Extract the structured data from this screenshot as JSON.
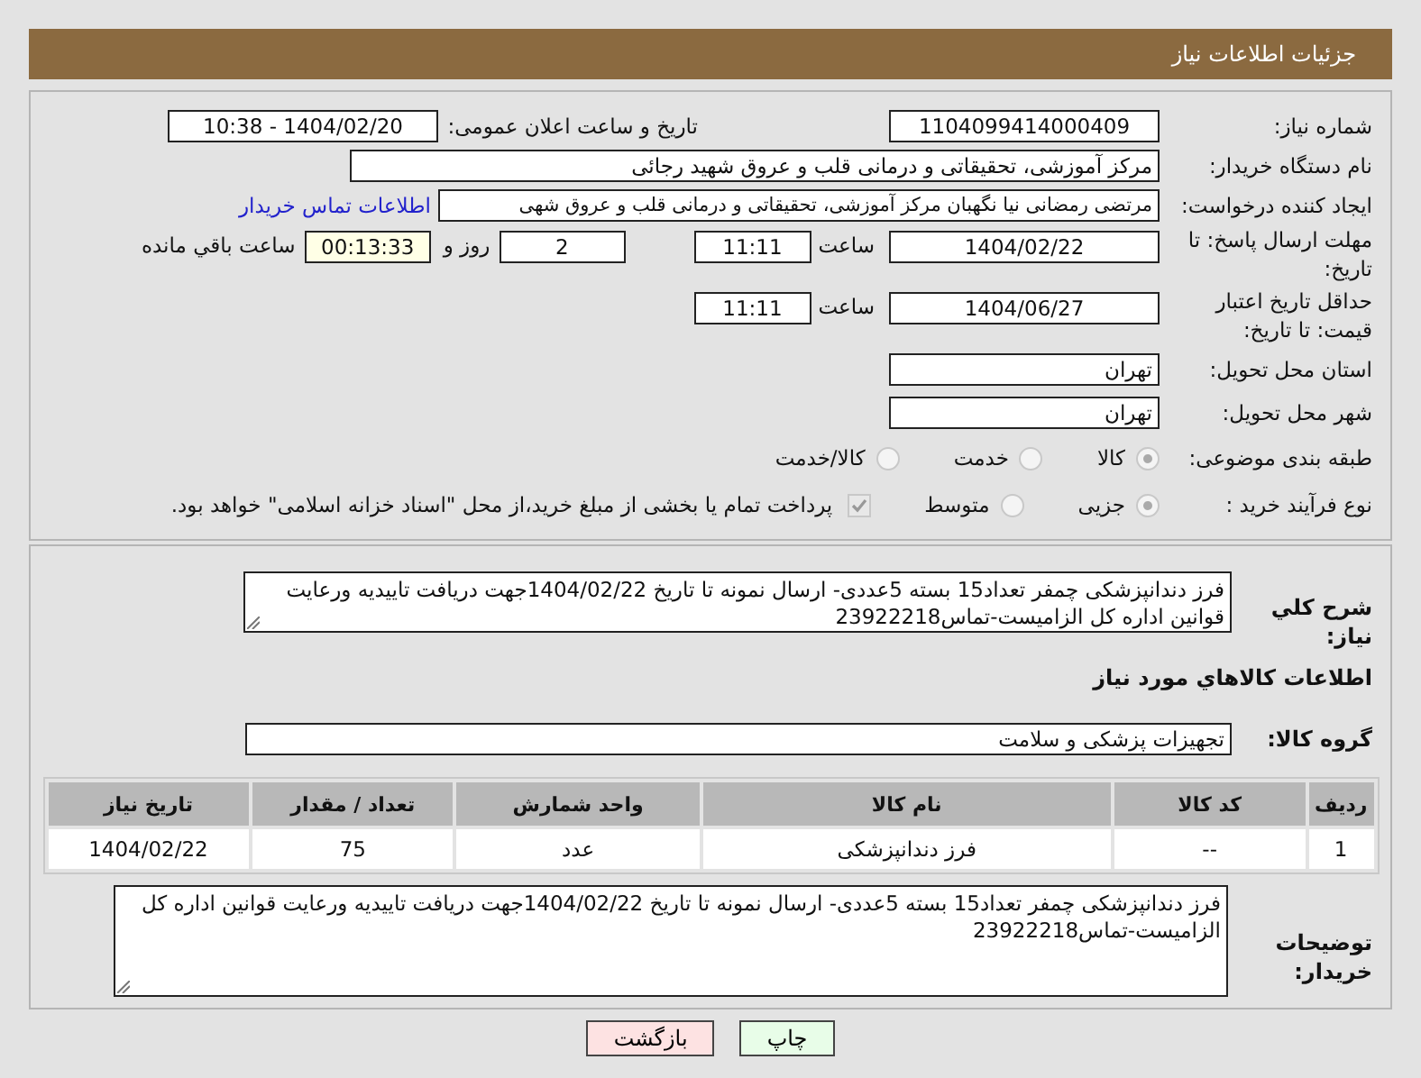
{
  "header": {
    "title": "جزئیات اطلاعات نیاز"
  },
  "need_number": {
    "label": "شماره نیاز:",
    "value": "1104099414000409"
  },
  "announce": {
    "label": "تاریخ و ساعت اعلان عمومی:",
    "value": "1404/02/20 - 10:38"
  },
  "buyer": {
    "label": "نام دستگاه خریدار:",
    "value": "مرکز آموزشی، تحقیقاتی و درمانی قلب و عروق شهید رجائی"
  },
  "creator": {
    "label": "ایجاد کننده درخواست:",
    "value": "مرتضی رمضانی نیا نگهبان مرکز آموزشی، تحقیقاتی و درمانی قلب و عروق شهی",
    "link": "اطلاعات تماس خریدار"
  },
  "deadline": {
    "label": "مهلت ارسال پاسخ: تا تاریخ:",
    "date": "1404/02/22",
    "time_label": "ساعت",
    "time": "11:11",
    "days": "2",
    "days_label": "روز و",
    "remaining": "00:13:33",
    "remaining_label": "ساعت باقي مانده"
  },
  "price_validity": {
    "label": "حداقل تاریخ اعتبار قیمت: تا تاریخ:",
    "date": "1404/06/27",
    "time_label": "ساعت",
    "time": "11:11"
  },
  "province": {
    "label": "استان محل تحویل:",
    "value": "تهران"
  },
  "city": {
    "label": "شهر محل تحویل:",
    "value": "تهران"
  },
  "category": {
    "label": "طبقه بندی موضوعی:",
    "options": [
      {
        "label": "کالا",
        "selected": true
      },
      {
        "label": "خدمت",
        "selected": false
      },
      {
        "label": "کالا/خدمت",
        "selected": false
      }
    ]
  },
  "process": {
    "label": "نوع فرآیند خرید :",
    "options": [
      {
        "label": "جزیی",
        "selected": true
      },
      {
        "label": "متوسط",
        "selected": false
      }
    ],
    "payment": {
      "checked": true,
      "label": "پرداخت تمام یا بخشی از مبلغ خرید،از محل \"اسناد خزانه اسلامی\" خواهد بود."
    }
  },
  "summary": {
    "label": "شرح كلي نیاز:",
    "value": "فرز دندانپزشکی چمفر تعداد15 بسته 5عددی- ارسال نمونه تا تاریخ 1404/02/22جهت دریافت تاییدیه ورعایت قوانین اداره کل الزامیست-تماس23922218"
  },
  "goods_heading": "اطلاعات کالاهاي مورد نیاز",
  "goods_group": {
    "label": "گروه کالا:",
    "value": "تجهیزات پزشکی و سلامت"
  },
  "table": {
    "columns": [
      "ردیف",
      "کد کالا",
      "نام کالا",
      "واحد شمارش",
      "تعداد / مقدار",
      "تاریخ نیاز"
    ],
    "rows": [
      [
        "1",
        "--",
        "فرز دندانپزشکی",
        "عدد",
        "75",
        "1404/02/22"
      ]
    ]
  },
  "buyer_notes": {
    "label": "توضیحات خریدار:",
    "value": "فرز دندانپزشکی چمفر تعداد15 بسته 5عددی- ارسال نمونه تا تاریخ 1404/02/22جهت دریافت تاییدیه ورعایت قوانین اداره کل الزامیست-تماس23922218"
  },
  "buttons": [
    {
      "label": "چاپ",
      "kind": "print"
    },
    {
      "label": "بازگشت",
      "kind": "back"
    }
  ]
}
